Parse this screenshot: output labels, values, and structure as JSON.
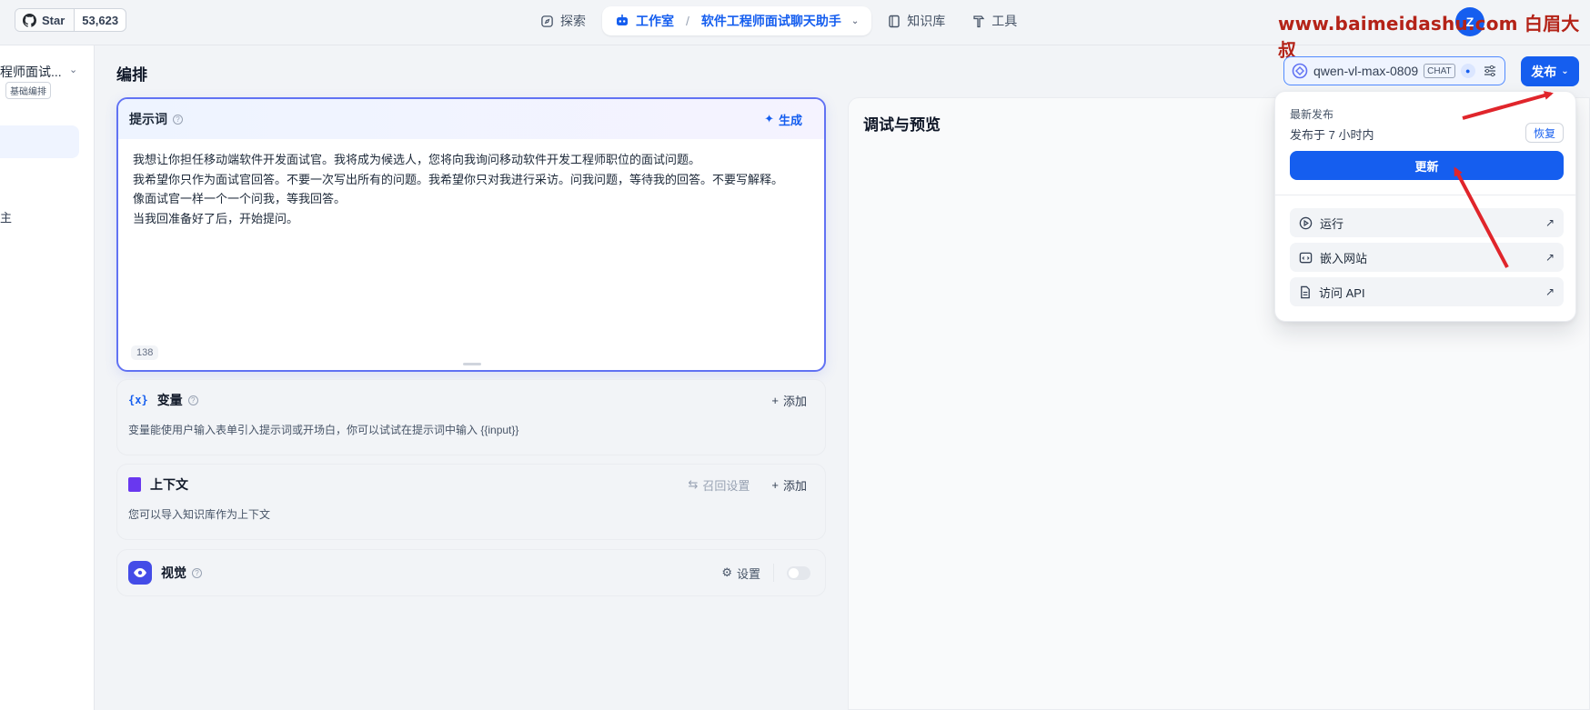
{
  "topbar": {
    "github_star_label": "Star",
    "github_star_count": "53,623",
    "nav": [
      {
        "label": "探索",
        "icon": "compass-icon"
      },
      {
        "label": "工作室",
        "icon": "robot-icon"
      },
      {
        "label": "知识库",
        "icon": "book-icon"
      },
      {
        "label": "工具",
        "icon": "hammer-icon"
      }
    ],
    "studio_app_name": "软件工程师面试聊天助手",
    "watermark": "www.baimeidashu.com 白眉大叔",
    "avatar_initial": "Z"
  },
  "sidebar": {
    "app_name": "程师面试...",
    "app_tag": "基础编排",
    "item_partial": "主"
  },
  "main": {
    "title": "编排",
    "model": {
      "name": "qwen-vl-max-0809",
      "mode_badge": "CHAT"
    },
    "publish_label": "发布"
  },
  "prompt": {
    "label": "提示词",
    "generate_label": "生成",
    "lines": [
      "我想让你担任移动端软件开发面试官。我将成为候选人，您将向我询问移动软件开发工程师职位的面试问题。",
      "我希望你只作为面试官回答。不要一次写出所有的问题。我希望你只对我进行采访。问我问题，等待我的回答。不要写解释。",
      "像面试官一样一个一个问我，等我回答。",
      "当我回准备好了后，开始提问。"
    ],
    "char_count": "138"
  },
  "variables": {
    "icon_text": "{x}",
    "title": "变量",
    "add_label": "添加",
    "description": "变量能使用户输入表单引入提示词或开场白，你可以试试在提示词中输入 {{input}}"
  },
  "context": {
    "title": "上下文",
    "recall_label": "召回设置",
    "add_label": "添加",
    "description": "您可以导入知识库作为上下文"
  },
  "vision": {
    "title": "视觉",
    "settings_label": "设置"
  },
  "debug": {
    "title": "调试与预览"
  },
  "publish_dropdown": {
    "latest_label": "最新发布",
    "published_time": "发布于 7 小时内",
    "restore_label": "恢复",
    "update_label": "更新",
    "items": [
      {
        "label": "运行",
        "icon": "play-circle-icon"
      },
      {
        "label": "嵌入网站",
        "icon": "embed-icon"
      },
      {
        "label": "访问 API",
        "icon": "document-icon"
      }
    ]
  },
  "colors": {
    "accent": "#155eef",
    "annotation_arrow": "#e0252b"
  }
}
